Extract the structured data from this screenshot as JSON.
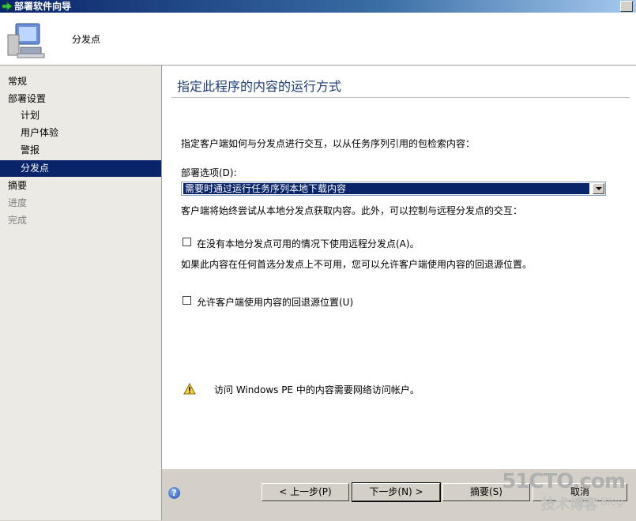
{
  "window": {
    "title": "部署软件向导"
  },
  "header": {
    "title": "分发点"
  },
  "sidebar": {
    "items": [
      {
        "label": "常规"
      },
      {
        "label": "部署设置"
      },
      {
        "label": "计划"
      },
      {
        "label": "用户体验"
      },
      {
        "label": "警报"
      },
      {
        "label": "分发点"
      },
      {
        "label": "摘要"
      },
      {
        "label": "进度"
      },
      {
        "label": "完成"
      }
    ],
    "selected": "分发点"
  },
  "main": {
    "title": "指定此程序的内容的运行方式",
    "intro": "指定客户端如何与分发点进行交互，以从任务序列引用的包检索内容：",
    "deploy_option_label": "部署选项(D):",
    "deploy_option_value": "需要时通过运行任务序列本地下载内容",
    "deploy_option_desc": "客户端将始终尝试从本地分发点获取内容。此外，可以控制与远程分发点的交互：",
    "checkbox_remote": {
      "label": "在没有本地分发点可用的情况下使用远程分发点(A)。",
      "checked": false
    },
    "fallback_desc": "如果此内容在任何首选分发点上不可用，您可以允许客户端使用内容的回退源位置。",
    "checkbox_fallback": {
      "label": "允许客户端使用内容的回退源位置(U)",
      "checked": false
    },
    "warning": "访问 Windows PE 中的内容需要网络访问帐户。"
  },
  "footer": {
    "prev": "< 上一步(P)",
    "next": "下一步(N) >",
    "summary": "摘要(S)",
    "cancel": "取消"
  },
  "watermark": {
    "site": "51CTO.com",
    "sub": "技术博客",
    "blog": "Blog"
  }
}
